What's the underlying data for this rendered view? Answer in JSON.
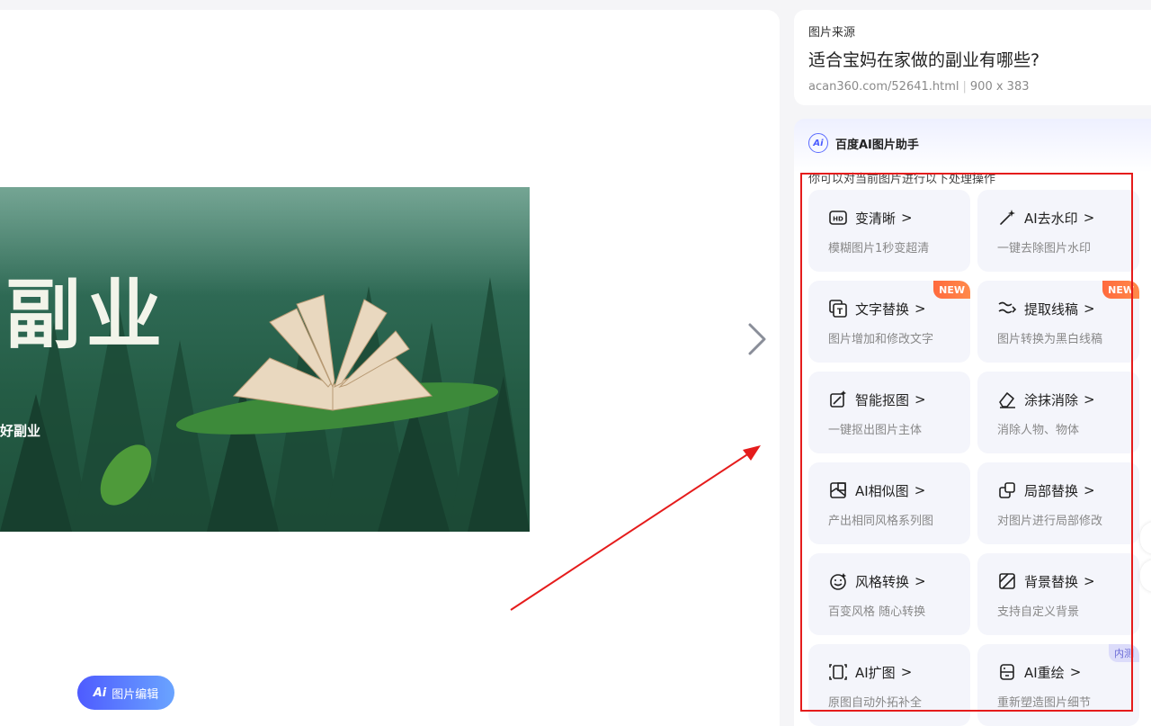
{
  "image": {
    "title_big": "副业",
    "title_small": "好副业"
  },
  "source": {
    "label": "图片来源",
    "title": "适合宝妈在家做的副业有哪些?",
    "url": "acan360.com/52641.html",
    "separator": "|",
    "dimensions": "900 x 383"
  },
  "edit_button": {
    "ai": "Ai",
    "label": "图片编辑"
  },
  "assistant": {
    "logo": "Ai",
    "title": "百度AI图片助手",
    "subtitle": "你可以对当前图片进行以下处理操作",
    "tools": [
      {
        "name": "变清晰",
        "desc": "模糊图片1秒变超清",
        "icon": "hd-icon",
        "badge": ""
      },
      {
        "name": "AI去水印",
        "desc": "一键去除图片水印",
        "icon": "magic-wand-icon",
        "badge": ""
      },
      {
        "name": "文字替换",
        "desc": "图片增加和修改文字",
        "icon": "text-replace-icon",
        "badge": "NEW"
      },
      {
        "name": "提取线稿",
        "desc": "图片转换为黑白线稿",
        "icon": "line-art-icon",
        "badge": "NEW"
      },
      {
        "name": "智能抠图",
        "desc": "一键抠出图片主体",
        "icon": "cutout-icon",
        "badge": ""
      },
      {
        "name": "涂抹消除",
        "desc": "消除人物、物体",
        "icon": "eraser-icon",
        "badge": ""
      },
      {
        "name": "AI相似图",
        "desc": "产出相同风格系列图",
        "icon": "similar-image-icon",
        "badge": ""
      },
      {
        "name": "局部替换",
        "desc": "对图片进行局部修改",
        "icon": "partial-replace-icon",
        "badge": ""
      },
      {
        "name": "风格转换",
        "desc": "百变风格 随心转换",
        "icon": "style-icon",
        "badge": ""
      },
      {
        "name": "背景替换",
        "desc": "支持自定义背景",
        "icon": "background-icon",
        "badge": ""
      },
      {
        "name": "AI扩图",
        "desc": "原图自动外拓补全",
        "icon": "expand-icon",
        "badge": ""
      },
      {
        "name": "AI重绘",
        "desc": "重新塑造图片细节",
        "icon": "redraw-icon",
        "badge": "内测"
      }
    ],
    "chevron": ">"
  },
  "colors": {
    "accent": "#4e5bff",
    "annotation_red": "#e51c1c",
    "badge_new": "#ff6a3d"
  }
}
